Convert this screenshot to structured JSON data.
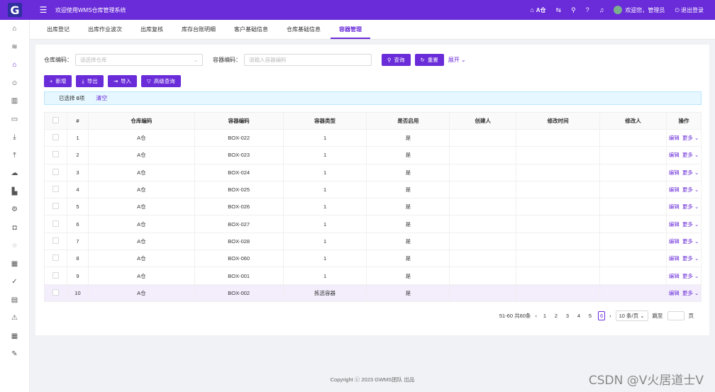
{
  "header": {
    "logo_letter": "G",
    "title": "欢迎使用WMS仓库管理系统",
    "warehouse": "A仓",
    "user_greeting": "欢迎您，管理员",
    "logout": "退出登录"
  },
  "tabs": [
    "出库登记",
    "出库作业波次",
    "出库复核",
    "库存台账明细",
    "客户基础信息",
    "仓库基础信息",
    "容器管理"
  ],
  "active_tab": "容器管理",
  "search": {
    "warehouse_label": "仓库编码：",
    "warehouse_placeholder": "请选择仓库",
    "container_label": "容器编码：",
    "container_placeholder": "请输入容器编码",
    "query_btn": "查询",
    "reset_btn": "重置",
    "expand": "展开"
  },
  "toolbar": {
    "add": "新增",
    "export": "导出",
    "import": "导入",
    "advanced": "高级查询"
  },
  "alert": {
    "selected_prefix": "已选择",
    "selected_count": "0",
    "selected_suffix": "项",
    "clear": "清空"
  },
  "table": {
    "headers": [
      "#",
      "仓库编码",
      "容器编码",
      "容器类型",
      "是否启用",
      "创建人",
      "修改时间",
      "修改人",
      "操作"
    ],
    "edit": "编辑",
    "more": "更多",
    "rows": [
      [
        "1",
        "A仓",
        "BOX-022",
        "1",
        "是"
      ],
      [
        "2",
        "A仓",
        "BOX-023",
        "1",
        "是"
      ],
      [
        "3",
        "A仓",
        "BOX-024",
        "1",
        "是"
      ],
      [
        "4",
        "A仓",
        "BOX-025",
        "1",
        "是"
      ],
      [
        "5",
        "A仓",
        "BOX-026",
        "1",
        "是"
      ],
      [
        "6",
        "A仓",
        "BOX-027",
        "1",
        "是"
      ],
      [
        "7",
        "A仓",
        "BOX-028",
        "1",
        "是"
      ],
      [
        "8",
        "A仓",
        "BOX-060",
        "1",
        "是"
      ],
      [
        "9",
        "A仓",
        "BOX-001",
        "1",
        "是"
      ],
      [
        "10",
        "A仓",
        "BOX-002",
        "拣选容器",
        "是"
      ]
    ]
  },
  "pagination": {
    "range": "51-60 共60条",
    "pages": [
      "1",
      "2",
      "3",
      "4",
      "5",
      "6"
    ],
    "current": "6",
    "size": "10 条/页",
    "jump_label": "跳至",
    "page_unit": "页"
  },
  "footer": "Copyright ⓒ 2023 GWMS团队 出品",
  "watermark": "CSDN @V火居道士V"
}
